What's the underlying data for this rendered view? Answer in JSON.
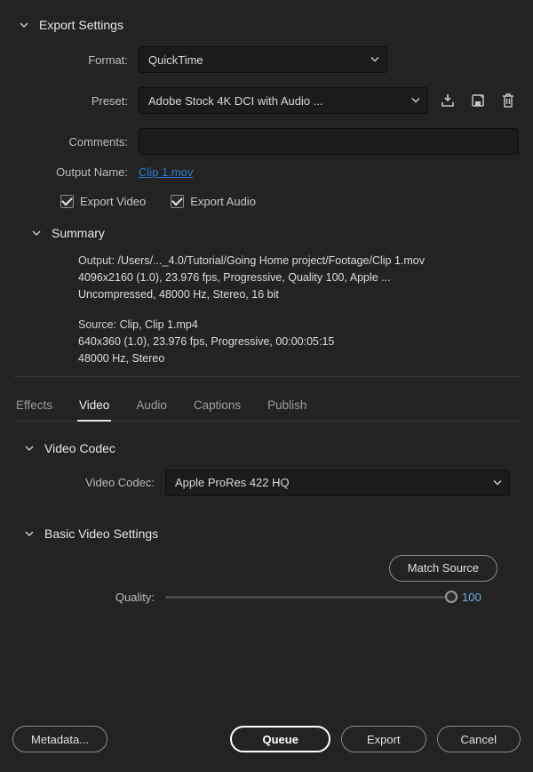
{
  "export_settings": {
    "title": "Export Settings",
    "format_label": "Format:",
    "format_value": "QuickTime",
    "preset_label": "Preset:",
    "preset_value": "Adobe Stock 4K DCI with Audio ...",
    "comments_label": "Comments:",
    "comments_value": "",
    "output_name_label": "Output Name:",
    "output_name_value": "Clip 1.mov",
    "export_video_label": "Export Video",
    "export_audio_label": "Export Audio"
  },
  "summary": {
    "title": "Summary",
    "output_label": "Output:",
    "output_line1": "/Users/..._4.0/Tutorial/Going Home project/Footage/Clip 1.mov",
    "output_line2": "4096x2160 (1.0), 23.976 fps, Progressive, Quality 100, Apple ...",
    "output_line3": "Uncompressed, 48000 Hz, Stereo, 16 bit",
    "source_label": "Source:",
    "source_line1": "Clip, Clip 1.mp4",
    "source_line2": "640x360 (1.0), 23.976 fps, Progressive, 00:00:05:15",
    "source_line3": "48000 Hz, Stereo"
  },
  "tabs": {
    "effects": "Effects",
    "video": "Video",
    "audio": "Audio",
    "captions": "Captions",
    "publish": "Publish"
  },
  "video_codec": {
    "title": "Video Codec",
    "label": "Video Codec:",
    "value": "Apple ProRes 422 HQ"
  },
  "basic_video": {
    "title": "Basic Video Settings",
    "match_source": "Match Source",
    "quality_label": "Quality:",
    "quality_value": "100"
  },
  "footer": {
    "metadata": "Metadata...",
    "queue": "Queue",
    "export": "Export",
    "cancel": "Cancel"
  }
}
